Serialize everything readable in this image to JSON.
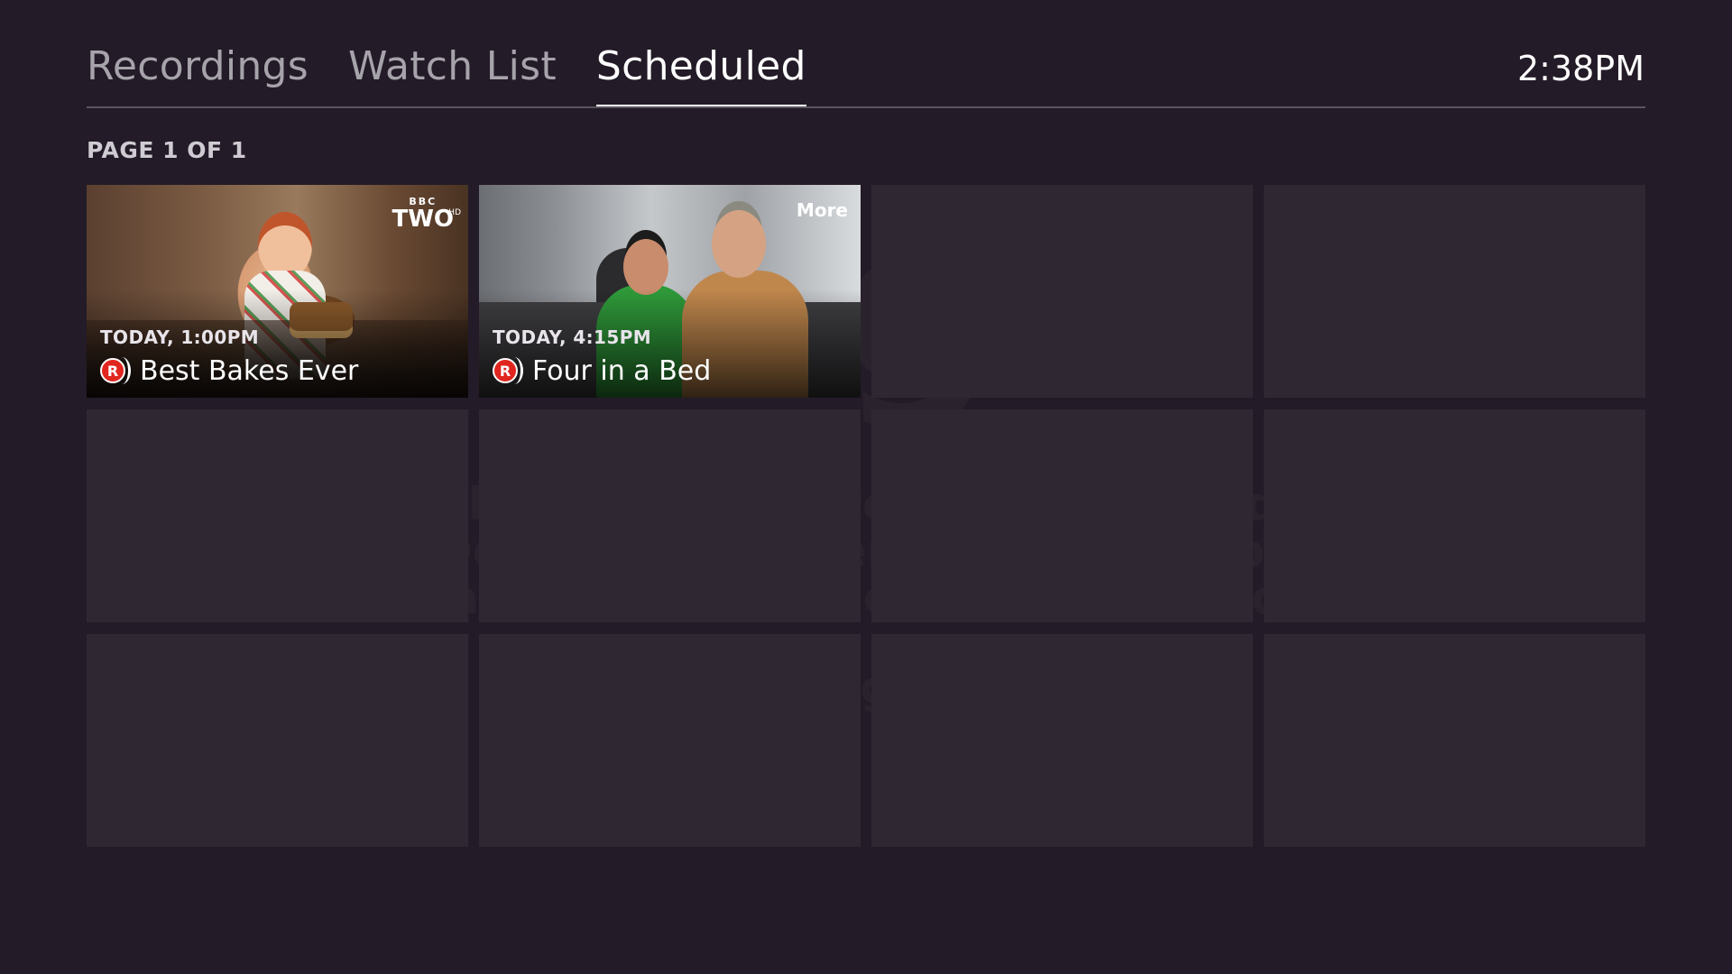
{
  "tabs": [
    {
      "label": "Recordings",
      "active": false
    },
    {
      "label": "Watch List",
      "active": false
    },
    {
      "label": "Scheduled",
      "active": true
    }
  ],
  "clock": "2:38PM",
  "page_indicator": "PAGE 1 OF 1",
  "scheduled": [
    {
      "when": "TODAY, 1:00PM",
      "title": "Best Bakes Ever",
      "rec_icon": "R",
      "channel": {
        "line1": "BBC",
        "line2": "TWO",
        "badge": "HD"
      }
    },
    {
      "when": "TODAY, 4:15PM",
      "title": "Four in a Bed",
      "rec_icon": "R",
      "channel": {
        "line1": "More"
      }
    }
  ],
  "background_text": {
    "line1": "Follow us on twitter @KerrangRadio",
    "line2": "Download the Kerrang! Radio app",
    "line3": "available for iPhone and Android",
    "url": "www.kerrangradio.co.uk",
    "slogan": "Everything That Rocks"
  },
  "colors": {
    "background": "#231b27",
    "tile": "#2f2833",
    "record_red": "#e0261e",
    "active_underline": "#ffffff"
  }
}
